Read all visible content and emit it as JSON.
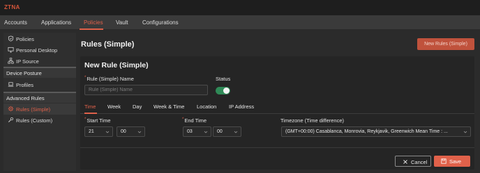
{
  "app": {
    "brand": "ZTNA"
  },
  "nav": [
    "Accounts",
    "Applications",
    "Policies",
    "Vault",
    "Configurations"
  ],
  "sidebar": {
    "policies": "Policies",
    "personal_desktop": "Personal Desktop",
    "ip_source": "IP Source",
    "device_posture": "Device Posture",
    "profiles": "Profiles",
    "advanced_rules": "Advanced Rules",
    "rules_simple": "Rules (Simple)",
    "rules_custom": "Rules (Custom)"
  },
  "page": {
    "title": "Rules (Simple)",
    "new_button": "New Rules (Simple)"
  },
  "form": {
    "title": "New Rule (Simple)",
    "name_label": "Rule (Simple) Name",
    "name_placeholder": "Rule (Simple) Name",
    "name_value": "",
    "status_label": "Status",
    "status_on": true,
    "tabs": [
      "Time",
      "Week",
      "Day",
      "Week & Time",
      "Location",
      "IP Address"
    ],
    "active_tab": "Time",
    "start_time_label": "Start Time",
    "start_hour": "21",
    "start_minute": "00",
    "end_time_label": "End Time",
    "end_hour": "03",
    "end_minute": "00",
    "timezone_label": "Timezone (Time difference)",
    "timezone_value": "(GMT+00:00) Casablanca, Monrovia, Reykjavik, Greenwich Mean Time : ...",
    "cancel": "Cancel",
    "save": "Save"
  },
  "colors": {
    "accent": "#e0614a",
    "toggle_on": "#2f8a57",
    "background": "#2b2b2b"
  }
}
